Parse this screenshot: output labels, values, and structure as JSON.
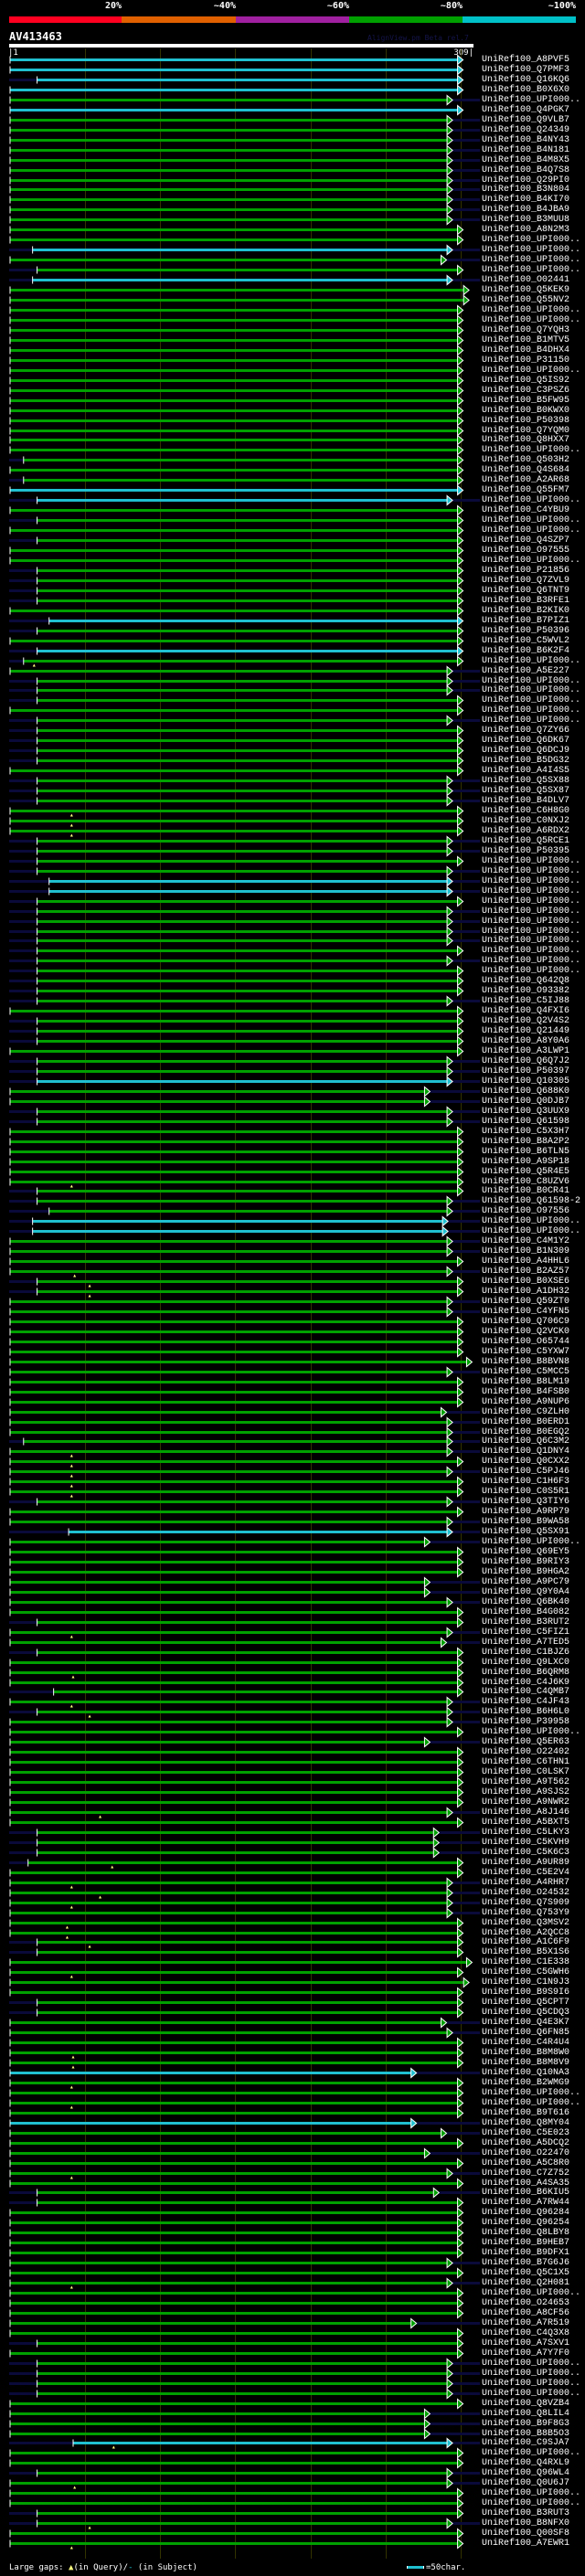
{
  "identity_scale": {
    "labels": [
      "20%",
      "~40%",
      "~60%",
      "~80%",
      "~100%"
    ],
    "colors": [
      "#ff0020",
      "#e06000",
      "#a020a0",
      "#00a000",
      "#00c0c8"
    ]
  },
  "query": {
    "id": "AV413463",
    "start_label": "|1",
    "end_label": "309|",
    "length": 309
  },
  "credit": "AlignView.pm Beta rel.7",
  "colors": {
    "g": "#00a000",
    "c": "#20c0d0",
    "subject_overhang": "#0a0a3a",
    "grid": "#333300",
    "gap": "#ffff80"
  },
  "footer": {
    "prefix": "Large gaps: ",
    "query_glyph": "▲",
    "query_text": "(in Query)/",
    "subject_glyph": "-",
    "subject_text": " (in Subject)",
    "scale_text": "=50char."
  },
  "rows": [
    [
      "UniRef100_A8PVF5",
      1,
      299,
      "c"
    ],
    [
      "UniRef100_Q7PMF3",
      1,
      299,
      "c"
    ],
    [
      "UniRef100_Q16KQ6",
      19,
      299,
      "c"
    ],
    [
      "UniRef100_B0X6X0",
      1,
      299,
      "c"
    ],
    [
      "UniRef100_UPI000..",
      1,
      292,
      "g"
    ],
    [
      "UniRef100_Q4PGK7",
      1,
      299,
      "c"
    ],
    [
      "UniRef100_Q9VLB7",
      1,
      292,
      "g"
    ],
    [
      "UniRef100_Q24349",
      1,
      292,
      "g"
    ],
    [
      "UniRef100_B4NY43",
      1,
      292,
      "g"
    ],
    [
      "UniRef100_B4N181",
      1,
      292,
      "g"
    ],
    [
      "UniRef100_B4M8X5",
      1,
      292,
      "g"
    ],
    [
      "UniRef100_B4Q7S8",
      1,
      292,
      "g"
    ],
    [
      "UniRef100_Q29PI0",
      1,
      292,
      "g"
    ],
    [
      "UniRef100_B3N804",
      1,
      292,
      "g"
    ],
    [
      "UniRef100_B4KI70",
      1,
      292,
      "g"
    ],
    [
      "UniRef100_B4JBA9",
      1,
      292,
      "g"
    ],
    [
      "UniRef100_B3MUU8",
      1,
      292,
      "g"
    ],
    [
      "UniRef100_A8N2M3",
      1,
      299,
      "g"
    ],
    [
      "UniRef100_UPI000..",
      1,
      299,
      "g"
    ],
    [
      "UniRef100_UPI000..",
      16,
      292,
      "c"
    ],
    [
      "UniRef100_UPI000..",
      1,
      288,
      "g"
    ],
    [
      "UniRef100_UPI000..",
      19,
      299,
      "g"
    ],
    [
      "UniRef100_O02441",
      16,
      292,
      "c"
    ],
    [
      "UniRef100_Q5KEK9",
      1,
      303,
      "g"
    ],
    [
      "UniRef100_Q55NV2",
      1,
      303,
      "g"
    ],
    [
      "UniRef100_UPI000..",
      1,
      299,
      "g"
    ],
    [
      "UniRef100_UPI000..",
      1,
      299,
      "g"
    ],
    [
      "UniRef100_Q7YQH3",
      1,
      299,
      "g"
    ],
    [
      "UniRef100_B1MTV5",
      1,
      299,
      "g"
    ],
    [
      "UniRef100_B4DHX4",
      1,
      299,
      "g"
    ],
    [
      "UniRef100_P31150",
      1,
      299,
      "g"
    ],
    [
      "UniRef100_UPI000..",
      1,
      299,
      "g"
    ],
    [
      "UniRef100_Q5IS92",
      1,
      299,
      "g"
    ],
    [
      "UniRef100_C3PSZ6",
      1,
      299,
      "g"
    ],
    [
      "UniRef100_B5FW95",
      1,
      299,
      "g"
    ],
    [
      "UniRef100_B0KWX0",
      1,
      299,
      "g"
    ],
    [
      "UniRef100_P50398",
      1,
      299,
      "g"
    ],
    [
      "UniRef100_Q7YQM0",
      1,
      299,
      "g"
    ],
    [
      "UniRef100_Q8HXX7",
      1,
      299,
      "g"
    ],
    [
      "UniRef100_UPI000..",
      1,
      299,
      "g"
    ],
    [
      "UniRef100_Q503H2",
      10,
      299,
      "g"
    ],
    [
      "UniRef100_Q4S684",
      1,
      299,
      "g"
    ],
    [
      "UniRef100_A2AR68",
      10,
      299,
      "g"
    ],
    [
      "UniRef100_Q55FM7",
      1,
      299,
      "c"
    ],
    [
      "UniRef100_UPI000..",
      19,
      292,
      "c"
    ],
    [
      "UniRef100_C4YBU9",
      1,
      299,
      "g"
    ],
    [
      "UniRef100_UPI000..",
      19,
      299,
      "g"
    ],
    [
      "UniRef100_UPI000..",
      1,
      299,
      "g"
    ],
    [
      "UniRef100_Q4SZP7",
      19,
      299,
      "g"
    ],
    [
      "UniRef100_O97555",
      1,
      299,
      "g"
    ],
    [
      "UniRef100_UPI000..",
      1,
      299,
      "g"
    ],
    [
      "UniRef100_P21856",
      19,
      299,
      "g"
    ],
    [
      "UniRef100_Q7ZVL9",
      19,
      299,
      "g"
    ],
    [
      "UniRef100_Q6TNT9",
      19,
      299,
      "g"
    ],
    [
      "UniRef100_B3RFE1",
      19,
      299,
      "g"
    ],
    [
      "UniRef100_B2KIK0",
      1,
      299,
      "g"
    ],
    [
      "UniRef100_B7PIZ1",
      27,
      299,
      "c"
    ],
    [
      "UniRef100_P50396",
      19,
      299,
      "g"
    ],
    [
      "UniRef100_C5WVL2",
      1,
      299,
      "g"
    ],
    [
      "UniRef100_B6K2F4",
      19,
      299,
      "c"
    ],
    [
      "UniRef100_UPI000..",
      10,
      299,
      "g",
      17
    ],
    [
      "UniRef100_A5E227",
      1,
      292,
      "g"
    ],
    [
      "UniRef100_UPI000..",
      19,
      292,
      "g"
    ],
    [
      "UniRef100_UPI000..",
      19,
      292,
      "g"
    ],
    [
      "UniRef100_UPI000..",
      19,
      299,
      "g"
    ],
    [
      "UniRef100_UPI000..",
      1,
      299,
      "g"
    ],
    [
      "UniRef100_UPI000..",
      19,
      292,
      "g"
    ],
    [
      "UniRef100_Q7ZY66",
      19,
      299,
      "g"
    ],
    [
      "UniRef100_Q6DK67",
      19,
      299,
      "g"
    ],
    [
      "UniRef100_Q6DCJ9",
      19,
      299,
      "g"
    ],
    [
      "UniRef100_B5DG32",
      19,
      299,
      "g"
    ],
    [
      "UniRef100_A4I4S5",
      1,
      299,
      "g"
    ],
    [
      "UniRef100_Q5SX88",
      19,
      292,
      "g"
    ],
    [
      "UniRef100_Q5SX87",
      19,
      292,
      "g"
    ],
    [
      "UniRef100_B4DLV7",
      19,
      292,
      "g"
    ],
    [
      "UniRef100_C6H8G0",
      1,
      299,
      "g",
      42
    ],
    [
      "UniRef100_C0NXJ2",
      1,
      299,
      "g",
      42
    ],
    [
      "UniRef100_A6RDX2",
      1,
      299,
      "g",
      42
    ],
    [
      "UniRef100_Q5RCE1",
      19,
      292,
      "g"
    ],
    [
      "UniRef100_P50395",
      19,
      292,
      "g"
    ],
    [
      "UniRef100_UPI000..",
      19,
      299,
      "g"
    ],
    [
      "UniRef100_UPI000..",
      19,
      292,
      "g"
    ],
    [
      "UniRef100_UPI000..",
      27,
      292,
      "c"
    ],
    [
      "UniRef100_UPI000..",
      27,
      292,
      "c"
    ],
    [
      "UniRef100_UPI000..",
      19,
      299,
      "g"
    ],
    [
      "UniRef100_UPI000..",
      19,
      292,
      "g"
    ],
    [
      "UniRef100_UPI000..",
      19,
      292,
      "g"
    ],
    [
      "UniRef100_UPI000..",
      19,
      292,
      "g"
    ],
    [
      "UniRef100_UPI000..",
      19,
      292,
      "g"
    ],
    [
      "UniRef100_UPI000..",
      19,
      299,
      "g"
    ],
    [
      "UniRef100_UPI000..",
      19,
      292,
      "g"
    ],
    [
      "UniRef100_UPI000..",
      19,
      299,
      "g"
    ],
    [
      "UniRef100_Q642Q8",
      19,
      299,
      "g"
    ],
    [
      "UniRef100_O93382",
      19,
      299,
      "g"
    ],
    [
      "UniRef100_C5IJ88",
      19,
      292,
      "g"
    ],
    [
      "UniRef100_Q4FXI6",
      1,
      299,
      "g"
    ],
    [
      "UniRef100_Q2V4S2",
      19,
      299,
      "g"
    ],
    [
      "UniRef100_Q21449",
      19,
      299,
      "g"
    ],
    [
      "UniRef100_A8Y0A6",
      19,
      299,
      "g"
    ],
    [
      "UniRef100_A3LWP1",
      1,
      299,
      "g"
    ],
    [
      "UniRef100_Q6Q7J2",
      19,
      292,
      "g"
    ],
    [
      "UniRef100_P50397",
      19,
      292,
      "g"
    ],
    [
      "UniRef100_Q10305",
      19,
      292,
      "c"
    ],
    [
      "UniRef100_Q688K0",
      1,
      277,
      "g"
    ],
    [
      "UniRef100_Q0DJB7",
      1,
      277,
      "g"
    ],
    [
      "UniRef100_Q3UUX9",
      19,
      292,
      "g"
    ],
    [
      "UniRef100_Q61598",
      19,
      292,
      "g"
    ],
    [
      "UniRef100_C5X3H7",
      1,
      299,
      "g"
    ],
    [
      "UniRef100_B8A2P2",
      1,
      299,
      "g"
    ],
    [
      "UniRef100_B6TLN5",
      1,
      299,
      "g"
    ],
    [
      "UniRef100_A9SP18",
      1,
      299,
      "g"
    ],
    [
      "UniRef100_Q5R4E5",
      1,
      299,
      "g"
    ],
    [
      "UniRef100_C8UZV6",
      1,
      299,
      "g",
      42
    ],
    [
      "UniRef100_B0CR41",
      19,
      299,
      "g"
    ],
    [
      "UniRef100_Q61598-2",
      19,
      292,
      "g"
    ],
    [
      "UniRef100_O97556",
      27,
      292,
      "g"
    ],
    [
      "UniRef100_UPI000..",
      16,
      289,
      "c"
    ],
    [
      "UniRef100_UPI000..",
      16,
      289,
      "c"
    ],
    [
      "UniRef100_C4M1Y2",
      1,
      292,
      "g"
    ],
    [
      "UniRef100_B1N309",
      1,
      292,
      "g"
    ],
    [
      "UniRef100_A4HHL6",
      1,
      299,
      "g"
    ],
    [
      "UniRef100_B2AZ57",
      1,
      292,
      "g",
      44
    ],
    [
      "UniRef100_B0XSE6",
      19,
      299,
      "g",
      54
    ],
    [
      "UniRef100_A1DH32",
      19,
      299,
      "g",
      54
    ],
    [
      "UniRef100_Q59ZT0",
      1,
      292,
      "g"
    ],
    [
      "UniRef100_C4YFN5",
      1,
      292,
      "g"
    ],
    [
      "UniRef100_Q706C9",
      1,
      299,
      "g"
    ],
    [
      "UniRef100_Q2VCK0",
      1,
      299,
      "g"
    ],
    [
      "UniRef100_O65744",
      1,
      299,
      "g"
    ],
    [
      "UniRef100_C5YXW7",
      1,
      299,
      "g"
    ],
    [
      "UniRef100_B8BVN8",
      1,
      305,
      "g"
    ],
    [
      "UniRef100_C5MCC5",
      1,
      292,
      "g"
    ],
    [
      "UniRef100_B8LM19",
      1,
      299,
      "g"
    ],
    [
      "UniRef100_B4FSB0",
      1,
      299,
      "g"
    ],
    [
      "UniRef100_A9NUP6",
      1,
      299,
      "g"
    ],
    [
      "UniRef100_C9ZLH0",
      1,
      288,
      "g"
    ],
    [
      "UniRef100_B0ERD1",
      1,
      292,
      "g"
    ],
    [
      "UniRef100_B0EGQ2",
      1,
      292,
      "g"
    ],
    [
      "UniRef100_Q6C3M2",
      10,
      292,
      "g"
    ],
    [
      "UniRef100_Q1DNY4",
      1,
      292,
      "g",
      42
    ],
    [
      "UniRef100_Q0CXX2",
      1,
      299,
      "g",
      42
    ],
    [
      "UniRef100_C5PJ46",
      1,
      292,
      "g",
      42
    ],
    [
      "UniRef100_C1H6F3",
      1,
      299,
      "g",
      42
    ],
    [
      "UniRef100_C0S5R1",
      1,
      299,
      "g",
      42
    ],
    [
      "UniRef100_Q3TIY6",
      19,
      292,
      "g"
    ],
    [
      "UniRef100_A9RP79",
      1,
      299,
      "g"
    ],
    [
      "UniRef100_B9WA58",
      1,
      292,
      "g"
    ],
    [
      "UniRef100_Q5SX91",
      40,
      292,
      "c"
    ],
    [
      "UniRef100_UPI000..",
      1,
      277,
      "g"
    ],
    [
      "UniRef100_Q69EY5",
      1,
      299,
      "g"
    ],
    [
      "UniRef100_B9RIY3",
      1,
      299,
      "g"
    ],
    [
      "UniRef100_B9HGA2",
      1,
      299,
      "g"
    ],
    [
      "UniRef100_A9PC79",
      1,
      277,
      "g"
    ],
    [
      "UniRef100_Q9Y0A4",
      1,
      277,
      "g"
    ],
    [
      "UniRef100_Q6BK40",
      1,
      292,
      "g"
    ],
    [
      "UniRef100_B4G082",
      1,
      299,
      "g"
    ],
    [
      "UniRef100_B3RUT2",
      19,
      299,
      "g"
    ],
    [
      "UniRef100_C5FIZ1",
      1,
      292,
      "g",
      42
    ],
    [
      "UniRef100_A7TED5",
      1,
      288,
      "g"
    ],
    [
      "UniRef100_C1BJZ6",
      19,
      299,
      "g"
    ],
    [
      "UniRef100_Q9LXC0",
      1,
      299,
      "g"
    ],
    [
      "UniRef100_B6QRM8",
      1,
      299,
      "g",
      43
    ],
    [
      "UniRef100_C4J6K9",
      1,
      299,
      "g"
    ],
    [
      "UniRef100_C4QMB7",
      30,
      299,
      "g"
    ],
    [
      "UniRef100_C4JF43",
      1,
      292,
      "g",
      42
    ],
    [
      "UniRef100_B6H6L0",
      19,
      292,
      "g",
      54
    ],
    [
      "UniRef100_P39958",
      1,
      292,
      "g"
    ],
    [
      "UniRef100_UPI000..",
      1,
      299,
      "g"
    ],
    [
      "UniRef100_Q5ER63",
      1,
      277,
      "g"
    ],
    [
      "UniRef100_O22402",
      1,
      299,
      "g"
    ],
    [
      "UniRef100_C6THN1",
      1,
      299,
      "g"
    ],
    [
      "UniRef100_C0LSK7",
      1,
      299,
      "g"
    ],
    [
      "UniRef100_A9T562",
      1,
      299,
      "g"
    ],
    [
      "UniRef100_A9SJS2",
      1,
      299,
      "g"
    ],
    [
      "UniRef100_A9NWR2",
      1,
      299,
      "g"
    ],
    [
      "UniRef100_A8J146",
      1,
      292,
      "g",
      61
    ],
    [
      "UniRef100_A5BXT5",
      1,
      299,
      "g"
    ],
    [
      "UniRef100_C5LKY3",
      19,
      283,
      "g"
    ],
    [
      "UniRef100_C5KVH9",
      19,
      283,
      "g"
    ],
    [
      "UniRef100_C5K6C3",
      19,
      283,
      "g"
    ],
    [
      "UniRef100_A9UR89",
      13,
      299,
      "g",
      69
    ],
    [
      "UniRef100_C5E2V4",
      1,
      299,
      "g"
    ],
    [
      "UniRef100_A4RHR7",
      1,
      292,
      "g",
      42
    ],
    [
      "UniRef100_O24532",
      1,
      292,
      "g",
      61
    ],
    [
      "UniRef100_Q7S909",
      1,
      292,
      "g",
      42
    ],
    [
      "UniRef100_Q753Y9",
      1,
      292,
      "g"
    ],
    [
      "UniRef100_Q3MSV2",
      1,
      299,
      "g",
      39
    ],
    [
      "UniRef100_A2QCC8",
      1,
      299,
      "g",
      39
    ],
    [
      "UniRef100_A1C6F9",
      19,
      299,
      "g",
      54
    ],
    [
      "UniRef100_B5X1S6",
      19,
      299,
      "g"
    ],
    [
      "UniRef100_C1E338",
      1,
      305,
      "g"
    ],
    [
      "UniRef100_C5GWH6",
      1,
      299,
      "g",
      42
    ],
    [
      "UniRef100_C1N9J3",
      1,
      303,
      "g"
    ],
    [
      "UniRef100_B9S9I6",
      1,
      299,
      "g"
    ],
    [
      "UniRef100_Q5CPT7",
      19,
      299,
      "g"
    ],
    [
      "UniRef100_Q5CDQ3",
      19,
      299,
      "g"
    ],
    [
      "UniRef100_Q4E3K7",
      1,
      288,
      "g"
    ],
    [
      "UniRef100_Q6FN85",
      1,
      292,
      "g"
    ],
    [
      "UniRef100_C4R4U4",
      1,
      299,
      "g"
    ],
    [
      "UniRef100_B8M8W0",
      1,
      299,
      "g",
      43
    ],
    [
      "UniRef100_B8M8V9",
      1,
      299,
      "g",
      43
    ],
    [
      "UniRef100_Q10NA3",
      1,
      268,
      "c"
    ],
    [
      "UniRef100_B2WMG9",
      1,
      299,
      "g",
      42
    ],
    [
      "UniRef100_UPI000..",
      1,
      299,
      "g"
    ],
    [
      "UniRef100_UPI000..",
      1,
      299,
      "g",
      42
    ],
    [
      "UniRef100_B9T616",
      1,
      299,
      "g"
    ],
    [
      "UniRef100_Q8MY04",
      1,
      268,
      "c"
    ],
    [
      "UniRef100_C5E023",
      1,
      288,
      "g"
    ],
    [
      "UniRef100_A5DCQ2",
      1,
      299,
      "g"
    ],
    [
      "UniRef100_O22470",
      1,
      277,
      "g"
    ],
    [
      "UniRef100_A5C8R0",
      1,
      299,
      "g"
    ],
    [
      "UniRef100_C7Z752",
      1,
      292,
      "g",
      42
    ],
    [
      "UniRef100_A4SA35",
      1,
      299,
      "g"
    ],
    [
      "UniRef100_B6KIU5",
      19,
      283,
      "g"
    ],
    [
      "UniRef100_A7RW44",
      19,
      299,
      "g"
    ],
    [
      "UniRef100_Q96284",
      1,
      299,
      "g"
    ],
    [
      "UniRef100_Q96254",
      1,
      299,
      "g"
    ],
    [
      "UniRef100_Q8LBY8",
      1,
      299,
      "g"
    ],
    [
      "UniRef100_B9HEB7",
      1,
      299,
      "g"
    ],
    [
      "UniRef100_B9DFX1",
      1,
      299,
      "g"
    ],
    [
      "UniRef100_B7G6J6",
      1,
      292,
      "g"
    ],
    [
      "UniRef100_Q5C1X5",
      1,
      299,
      "g"
    ],
    [
      "UniRef100_Q2H081",
      1,
      292,
      "g",
      42
    ],
    [
      "UniRef100_UPI000..",
      1,
      299,
      "g"
    ],
    [
      "UniRef100_O24653",
      1,
      299,
      "g"
    ],
    [
      "UniRef100_A8CF56",
      1,
      299,
      "g"
    ],
    [
      "UniRef100_A7R519",
      1,
      268,
      "g"
    ],
    [
      "UniRef100_C4Q3X8",
      1,
      299,
      "g"
    ],
    [
      "UniRef100_A7SXV1",
      19,
      299,
      "g"
    ],
    [
      "UniRef100_A7Y7F0",
      1,
      299,
      "g"
    ],
    [
      "UniRef100_UPI000..",
      19,
      292,
      "g"
    ],
    [
      "UniRef100_UPI000..",
      19,
      292,
      "g"
    ],
    [
      "UniRef100_UPI000..",
      19,
      292,
      "g"
    ],
    [
      "UniRef100_UPI000..",
      19,
      292,
      "g"
    ],
    [
      "UniRef100_Q8VZB4",
      1,
      299,
      "g"
    ],
    [
      "UniRef100_Q8LIL4",
      1,
      277,
      "g"
    ],
    [
      "UniRef100_B9F8G3",
      1,
      277,
      "g"
    ],
    [
      "UniRef100_B8B5O3",
      1,
      277,
      "g"
    ],
    [
      "UniRef100_C9SJA7",
      43,
      292,
      "c",
      70
    ],
    [
      "UniRef100_UPI000..",
      1,
      299,
      "g"
    ],
    [
      "UniRef100_Q4RXL9",
      1,
      299,
      "g"
    ],
    [
      "UniRef100_Q96WL4",
      19,
      292,
      "g"
    ],
    [
      "UniRef100_Q0U6J7",
      1,
      292,
      "g",
      44
    ],
    [
      "UniRef100_UPI000..",
      1,
      299,
      "g"
    ],
    [
      "UniRef100_UPI000..",
      1,
      299,
      "g"
    ],
    [
      "UniRef100_B3RUT3",
      19,
      299,
      "g"
    ],
    [
      "UniRef100_B8NFX0",
      19,
      292,
      "g",
      54
    ],
    [
      "UniRef100_Q00SF8",
      1,
      299,
      "g"
    ],
    [
      "UniRef100_A7EWR1",
      1,
      299,
      "g",
      42
    ]
  ]
}
